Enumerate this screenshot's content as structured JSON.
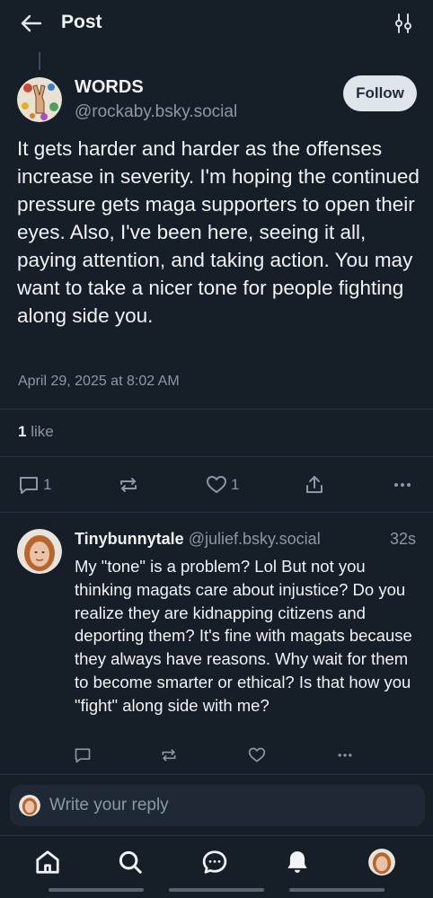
{
  "header": {
    "title": "Post",
    "back_icon": "arrow-left-icon",
    "filter_icon": "sliders-icon"
  },
  "post": {
    "author_name": "WORDS",
    "author_handle": "@rockaby.bsky.social",
    "follow_label": "Follow",
    "text": "It gets harder and harder as the offenses increase in severity. I'm hoping the continued pressure gets maga supporters to open their eyes. Also, I've been here, seeing it all, paying attention, and taking action. You may want to take a nicer tone for people fighting along side you.",
    "date": "April 29, 2025 at 8:02 AM",
    "likes_count": "1",
    "likes_label": " like",
    "actions": {
      "reply_count": "1",
      "like_count": "1"
    }
  },
  "reply": {
    "author_name": "Tinybunnytale",
    "author_handle": "@julief.bsky.social",
    "time": "32s",
    "text": "My \"tone\" is a problem? Lol But not you thinking magats care about injustice? Do you realize they are kidnapping citizens and deporting them? It's fine with magats because they always have reasons. Why wait for them to become smarter or ethical? Is that how you \"fight\" along side with me?"
  },
  "composer": {
    "placeholder": "Write your reply"
  },
  "nav": {
    "items": [
      "home-icon",
      "search-icon",
      "chat-icon",
      "bell-icon",
      "profile-avatar"
    ]
  },
  "colors": {
    "background": "#161e27",
    "muted_text": "#8b98a7",
    "divider": "#263140",
    "follow_button": "#dfe5ea"
  }
}
